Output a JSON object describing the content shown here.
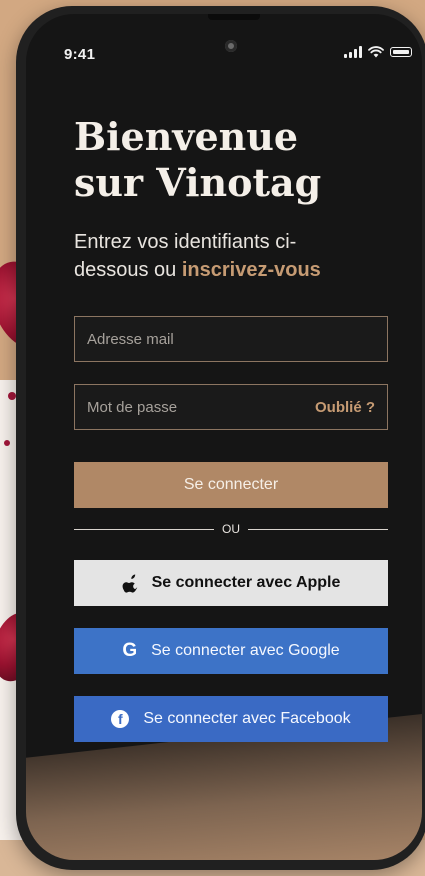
{
  "status_bar": {
    "time": "9:41"
  },
  "header": {
    "title": "Bienvenue sur Vinotag",
    "subtitle_prefix": "Entrez vos identifiants ci-dessous ou ",
    "subtitle_link": "inscrivez-vous"
  },
  "form": {
    "email_placeholder": "Adresse mail",
    "password_placeholder": "Mot de passe",
    "forgot_label": "Oublié ?",
    "login_label": "Se connecter"
  },
  "divider_label": "OU",
  "social": {
    "apple_label": "Se connecter avec Apple",
    "google_label": "Se connecter avec Google",
    "facebook_label": "Se connecter avec Facebook"
  },
  "colors": {
    "accent": "#c69b73",
    "login_button": "#b08866",
    "google_button": "#3d73c7",
    "facebook_button": "#3a6ac4",
    "screen_background": "#151515"
  },
  "icons": [
    "apple-icon",
    "google-icon",
    "facebook-icon",
    "signal-icon",
    "wifi-icon",
    "battery-icon"
  ]
}
